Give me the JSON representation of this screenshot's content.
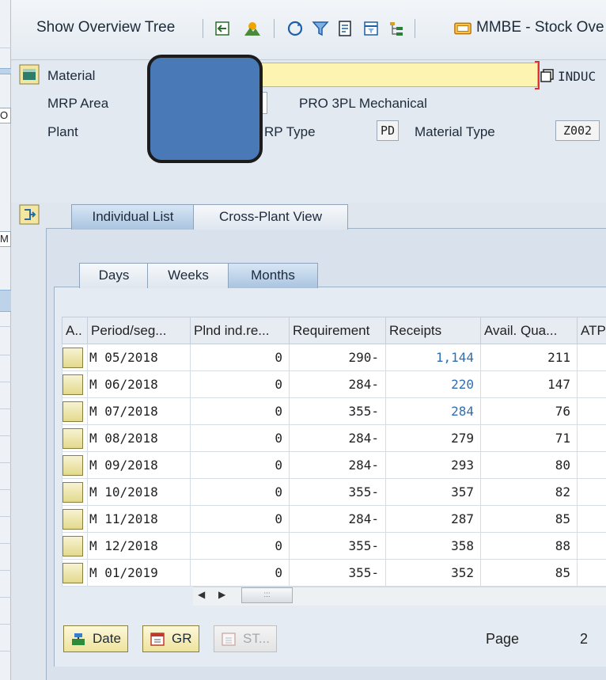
{
  "toolbar": {
    "show_overview_tree": "Show Overview Tree",
    "mmbe_button": "MMBE - Stock Ove"
  },
  "left_pane": {
    "field1_text": "O",
    "field2_text": "M"
  },
  "header": {
    "material_label": "Material",
    "material_suffix": "INDUC",
    "mrp_area_label": "MRP Area",
    "mrp_area_desc": "PRO 3PL Mechanical",
    "plant_label": "Plant",
    "mrp_type_label": "RP Type",
    "mrp_type_value": "PD",
    "material_type_label": "Material Type",
    "material_type_value": "Z002"
  },
  "tabs": {
    "outer": [
      "Individual List",
      "Cross-Plant View"
    ],
    "inner": [
      "Days",
      "Weeks",
      "Months"
    ]
  },
  "table": {
    "columns": [
      "A..",
      "Period/seg...",
      "Plnd ind.re...",
      "Requirement",
      "Receipts",
      "Avail. Qua...",
      "ATP"
    ],
    "rows": [
      {
        "period": "M 05/2018",
        "plnd": "0",
        "req": "290-",
        "receipts": "1,144",
        "avail": "211",
        "atp": ""
      },
      {
        "period": "M 06/2018",
        "plnd": "0",
        "req": "284-",
        "receipts": "220",
        "avail": "147",
        "atp": ""
      },
      {
        "period": "M 07/2018",
        "plnd": "0",
        "req": "355-",
        "receipts": "284",
        "avail": "76",
        "atp": ""
      },
      {
        "period": "M 08/2018",
        "plnd": "0",
        "req": "284-",
        "receipts": "279",
        "avail": "71",
        "atp": ""
      },
      {
        "period": "M 09/2018",
        "plnd": "0",
        "req": "284-",
        "receipts": "293",
        "avail": "80",
        "atp": ""
      },
      {
        "period": "M 10/2018",
        "plnd": "0",
        "req": "355-",
        "receipts": "357",
        "avail": "82",
        "atp": ""
      },
      {
        "period": "M 11/2018",
        "plnd": "0",
        "req": "284-",
        "receipts": "287",
        "avail": "85",
        "atp": ""
      },
      {
        "period": "M 12/2018",
        "plnd": "0",
        "req": "355-",
        "receipts": "358",
        "avail": "88",
        "atp": ""
      },
      {
        "period": "M 01/2019",
        "plnd": "0",
        "req": "355-",
        "receipts": "352",
        "avail": "85",
        "atp": ""
      }
    ]
  },
  "scroll": {
    "left_arrow": "◀",
    "right_arrow": "▶",
    "thumb_grip": ":::"
  },
  "buttons": {
    "date": "Date",
    "gr": "GR",
    "st": "ST..."
  },
  "pager": {
    "page_label": "Page",
    "page_number": "2"
  },
  "colors": {
    "material_field": "#fdf4b2",
    "redaction": "#4a79b8",
    "receipt_link": "#2f6fb2",
    "active_tab": "#a9c4e0"
  }
}
